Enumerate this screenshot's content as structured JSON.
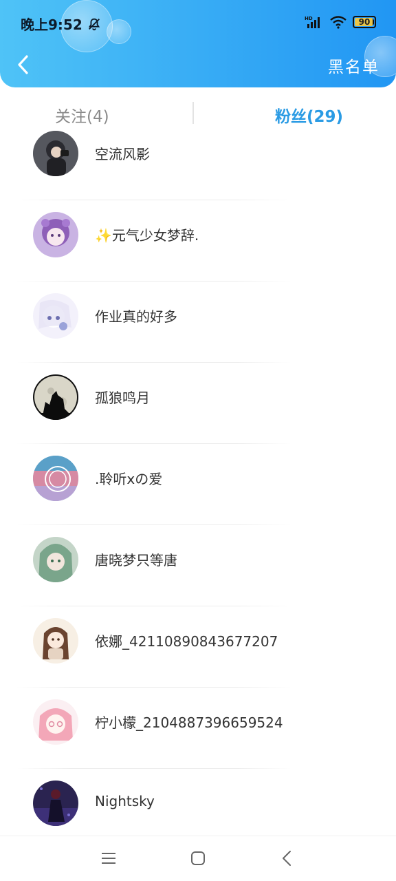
{
  "status_bar": {
    "time": "晚上9:52",
    "battery": "90"
  },
  "header": {
    "right_action": "黑名单"
  },
  "tabs": {
    "follow": "关注(4)",
    "fans": "粉丝(29)"
  },
  "fans": [
    {
      "name": "空流风影",
      "avatar": "dark-hair-boy"
    },
    {
      "name": "✨元气少女梦辞.",
      "avatar": "purple-anime-girl"
    },
    {
      "name": "作业真的好多",
      "avatar": "white-hair-girl"
    },
    {
      "name": "孤狼鸣月",
      "avatar": "wolf-moon"
    },
    {
      "name": ".聆听xの爱",
      "avatar": "colorful-scene"
    },
    {
      "name": "唐晓梦只等唐",
      "avatar": "green-hair-girl"
    },
    {
      "name": "依娜_42110890843677207",
      "avatar": "brown-hair-girl"
    },
    {
      "name": "柠小檬_2104887396659524",
      "avatar": "pink-hair-girl"
    },
    {
      "name": "Nightsky",
      "avatar": "dark-figure"
    }
  ],
  "colors": {
    "header_start": "#4fc3f7",
    "header_end": "#2196f3",
    "active_tab": "#2a9be4"
  }
}
